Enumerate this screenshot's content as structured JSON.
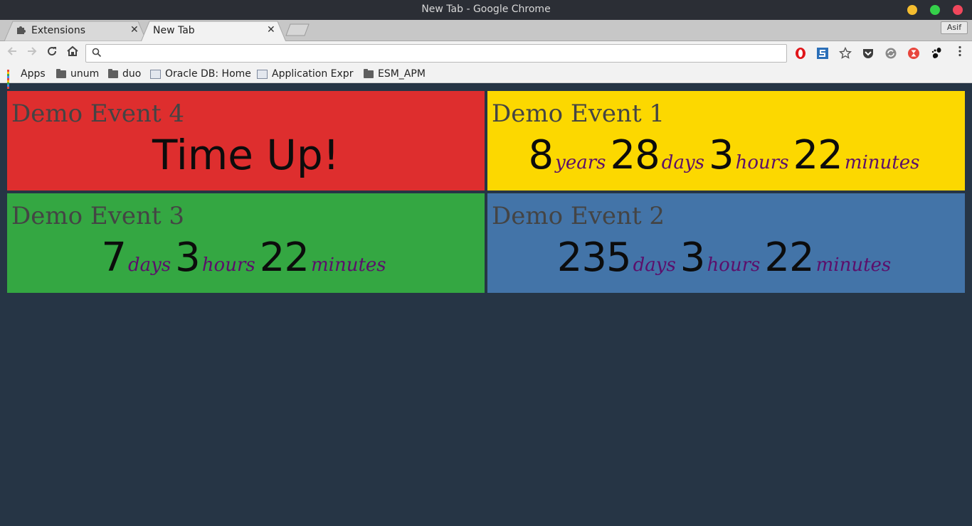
{
  "window": {
    "title": "New Tab - Google Chrome"
  },
  "tabs": [
    {
      "label": "Extensions",
      "icon": "puzzle-icon"
    },
    {
      "label": "New Tab",
      "icon": ""
    }
  ],
  "profile": {
    "label": "Asif"
  },
  "omnibox": {
    "value": "",
    "placeholder": ""
  },
  "bookmarks": [
    {
      "label": "Apps",
      "icon": "apps-grid-icon"
    },
    {
      "label": "unum",
      "icon": "folder-icon"
    },
    {
      "label": "duo",
      "icon": "folder-icon"
    },
    {
      "label": "Oracle DB: Home",
      "icon": "page-icon"
    },
    {
      "label": "Application Expr",
      "icon": "page-icon"
    },
    {
      "label": "ESM_APM",
      "icon": "folder-icon"
    }
  ],
  "extensions": [
    "opera-icon",
    "s-extension-icon",
    "star-icon",
    "pocket-icon",
    "sync-icon",
    "hourglass-icon",
    "gnome-icon",
    "menu-icon"
  ],
  "events": {
    "event4": {
      "name": "Demo Event 4",
      "status": "Time Up!",
      "color": "#de2e2e"
    },
    "event1": {
      "name": "Demo Event 1",
      "years": "8",
      "years_unit": "years",
      "days": "28",
      "days_unit": "days",
      "hours": "3",
      "hours_unit": "hours",
      "minutes": "22",
      "minutes_unit": "minutes",
      "color": "#fcd800"
    },
    "event3": {
      "name": "Demo Event 3",
      "days": "7",
      "days_unit": "days",
      "hours": "3",
      "hours_unit": "hours",
      "minutes": "22",
      "minutes_unit": "minutes",
      "color": "#34a742"
    },
    "event2": {
      "name": "Demo Event 2",
      "days": "235",
      "days_unit": "days",
      "hours": "3",
      "hours_unit": "hours",
      "minutes": "22",
      "minutes_unit": "minutes",
      "color": "#4374a8"
    }
  },
  "colors": {
    "background": "#263545",
    "unit_text": "#5c0f6b"
  }
}
